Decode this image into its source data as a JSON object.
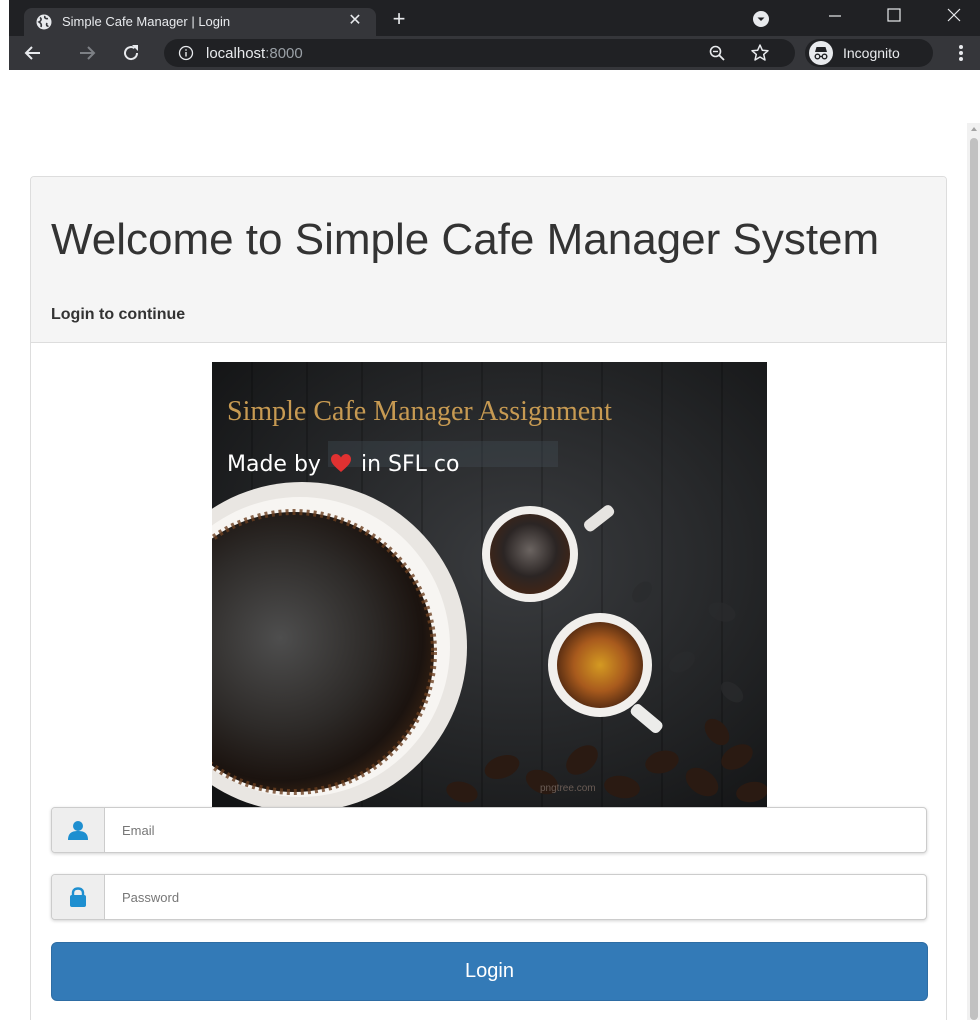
{
  "browser": {
    "tab_title": "Simple Cafe Manager | Login",
    "url_host": "localhost",
    "url_port": ":8000",
    "profile_label": "Incognito"
  },
  "page": {
    "title": "Welcome to Simple Cafe Manager System",
    "subtitle": "Login to continue"
  },
  "hero": {
    "title": "Simple Cafe Manager Assignment",
    "made_by": "Made by",
    "made_in": "in SFL co",
    "watermark": "pngtree.com"
  },
  "form": {
    "email_placeholder": "Email",
    "password_placeholder": "Password",
    "login_label": "Login"
  },
  "icons": {
    "email": "user-icon",
    "password": "lock-icon"
  },
  "colors": {
    "primary": "#337ab7",
    "addon_icon": "#1e8fd0",
    "chrome_dark": "#202124",
    "chrome_toolbar": "#35363a",
    "hero_title": "#c79a52",
    "heart": "#e03131"
  }
}
